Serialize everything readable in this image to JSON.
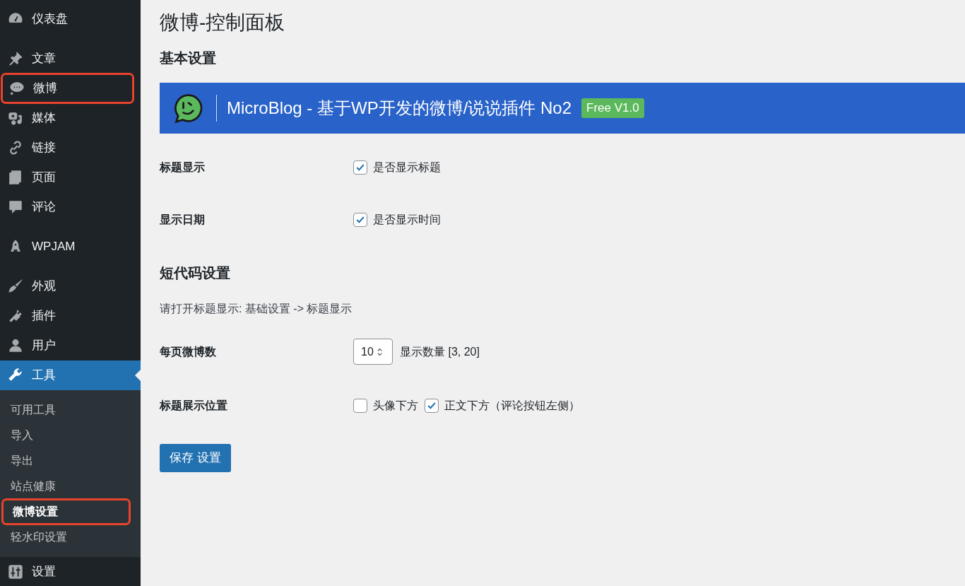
{
  "sidebar": {
    "groups": [
      {
        "items": [
          {
            "label": "仪表盘",
            "selected": false,
            "highlighted": false
          }
        ]
      },
      {
        "items": [
          {
            "label": "文章",
            "selected": false,
            "highlighted": false
          },
          {
            "label": "微博",
            "selected": false,
            "highlighted": true
          },
          {
            "label": "媒体",
            "selected": false,
            "highlighted": false
          },
          {
            "label": "链接",
            "selected": false,
            "highlighted": false
          },
          {
            "label": "页面",
            "selected": false,
            "highlighted": false
          },
          {
            "label": "评论",
            "selected": false,
            "highlighted": false
          }
        ]
      },
      {
        "items": [
          {
            "label": "WPJAM",
            "selected": false,
            "highlighted": false
          }
        ]
      },
      {
        "items": [
          {
            "label": "外观",
            "selected": false,
            "highlighted": false
          },
          {
            "label": "插件",
            "selected": false,
            "highlighted": false
          },
          {
            "label": "用户",
            "selected": false,
            "highlighted": false
          },
          {
            "label": "工具",
            "selected": true,
            "highlighted": false,
            "children": [
              {
                "label": "可用工具",
                "selected": false,
                "highlighted": false
              },
              {
                "label": "导入",
                "selected": false,
                "highlighted": false
              },
              {
                "label": "导出",
                "selected": false,
                "highlighted": false
              },
              {
                "label": "站点健康",
                "selected": false,
                "highlighted": false
              },
              {
                "label": "微博设置",
                "selected": true,
                "highlighted": true
              },
              {
                "label": "轻水印设置",
                "selected": false,
                "highlighted": false
              }
            ]
          },
          {
            "label": "设置",
            "selected": false,
            "highlighted": false
          }
        ]
      }
    ]
  },
  "page_title": "微博-控制面板",
  "sections": [
    {
      "heading": "基本设置",
      "banner": {
        "title": "MicroBlog - 基于WP开发的微博/说说插件 No2",
        "badge": "Free V1.0"
      },
      "fields": [
        {
          "kind": "checkbox",
          "label": "标题显示",
          "options": [
            {
              "label": "是否显示标题",
              "checked": true
            }
          ]
        },
        {
          "kind": "checkbox",
          "label": "显示日期",
          "options": [
            {
              "label": "是否显示时间",
              "checked": true
            }
          ]
        }
      ]
    },
    {
      "heading": "短代码设置",
      "note": "请打开标题显示: 基础设置 -> 标题显示",
      "fields": [
        {
          "kind": "number",
          "label": "每页微博数",
          "value": "10",
          "hint": "显示数量 [3, 20]"
        },
        {
          "kind": "checkbox",
          "label": "标题展示位置",
          "options": [
            {
              "label": "头像下方",
              "checked": false
            },
            {
              "label": "正文下方（评论按钮左侧）",
              "checked": true
            }
          ]
        }
      ]
    }
  ],
  "save_button": "保存 设置"
}
